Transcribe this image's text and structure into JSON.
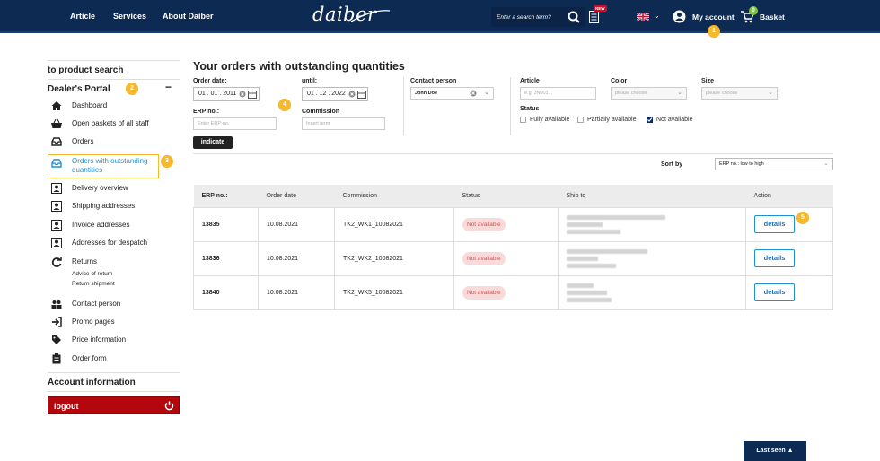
{
  "header": {
    "nav": [
      "Article",
      "Services",
      "About Daiber"
    ],
    "logo": "daiber",
    "search_placeholder": "Enter a search term?",
    "new_badge": "NEW",
    "account_label": "My account",
    "cart_count": "0",
    "basket_label": "Basket",
    "colors": {
      "bg": "#0d2a52",
      "accent": "#f5b82e",
      "cart_badge": "#7dc242"
    }
  },
  "markers": [
    "1",
    "2",
    "3",
    "4",
    "5"
  ],
  "sidebar": {
    "product_search": "to product search",
    "portal_title": "Dealer's Portal",
    "collapse": "−",
    "items": [
      {
        "label": "Dashboard",
        "icon": "house-icon"
      },
      {
        "label": "Open baskets of all staff",
        "icon": "basket-icon"
      },
      {
        "label": "Orders",
        "icon": "tray-icon"
      },
      {
        "label": "Orders with outstanding quantities",
        "icon": "tray-icon"
      },
      {
        "label": "Delivery overview",
        "icon": "person-card-icon"
      },
      {
        "label": "Shipping addresses",
        "icon": "person-card-icon"
      },
      {
        "label": "Invoice addresses",
        "icon": "person-card-icon"
      },
      {
        "label": "Addresses for despatch",
        "icon": "person-card-icon"
      },
      {
        "label": "Returns",
        "icon": "refresh-icon"
      },
      {
        "label": "Contact person",
        "icon": "people-icon"
      },
      {
        "label": "Promo pages",
        "icon": "sign-in-icon"
      },
      {
        "label": "Price information",
        "icon": "tag-icon"
      },
      {
        "label": "Order form",
        "icon": "clipboard-icon"
      }
    ],
    "returns_sub": [
      "Advice of return",
      "Return shipment"
    ],
    "account_info": "Account information",
    "logout": "logout"
  },
  "main": {
    "title": "Your orders with outstanding quantities",
    "filters": {
      "order_date_label": "Order date:",
      "order_date": "01 . 01 . 2011",
      "until_label": "until:",
      "until_date": "01 . 12 . 2022",
      "erp_label": "ERP no.:",
      "erp_placeholder": "Enter ERP-no.",
      "commission_label": "Commission",
      "commission_placeholder": "Insert term",
      "contact_label": "Contact person",
      "contact_value": "John Doe",
      "article_label": "Article",
      "article_placeholder": "e.g. JN001...",
      "color_label": "Color",
      "color_placeholder": "please choose",
      "size_label": "Size",
      "size_placeholder": "please choose",
      "status_label": "Status",
      "status_options": [
        {
          "label": "Fully available",
          "checked": false
        },
        {
          "label": "Partially available",
          "checked": false
        },
        {
          "label": "Not available",
          "checked": true
        }
      ],
      "indicate": "indicate"
    },
    "sort": {
      "label": "Sort by",
      "value": "ERP no.: low to high"
    },
    "table": {
      "headers": [
        "ERP no.:",
        "Order date",
        "Commission",
        "Status",
        "Ship to",
        "Action"
      ],
      "rows": [
        {
          "erp": "13835",
          "date": "10.08.2021",
          "commission": "TK2_WK1_10082021",
          "status": "Not available",
          "action": "details"
        },
        {
          "erp": "13836",
          "date": "10.08.2021",
          "commission": "TK2_WK2_10082021",
          "status": "Not available",
          "action": "details"
        },
        {
          "erp": "13840",
          "date": "10.08.2021",
          "commission": "TK2_WK5_10082021",
          "status": "Not available",
          "action": "details"
        }
      ]
    }
  },
  "footer": {
    "last_seen": "Last seen ▲"
  }
}
